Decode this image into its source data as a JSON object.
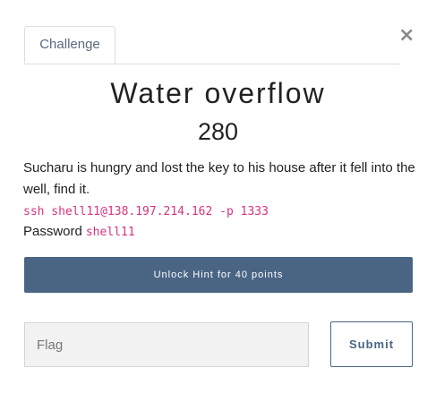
{
  "modal": {
    "close_glyph": "×"
  },
  "tabs": [
    {
      "label": "Challenge",
      "active": true
    }
  ],
  "challenge": {
    "name": "Water overflow",
    "points": "280",
    "description": "Sucharu is hungry and lost the key to his house after it fell into the well, find it.",
    "ssh_command": "ssh shell11@138.197.214.162 -p 1333",
    "password_label": "Password",
    "password_value": "shell11"
  },
  "hint_button": {
    "label": "Unlock Hint for 40 points"
  },
  "form": {
    "flag_placeholder": "Flag",
    "flag_value": "",
    "submit_label": "Submit"
  },
  "colors": {
    "accent": "#4a6584",
    "code": "#d6337e"
  }
}
